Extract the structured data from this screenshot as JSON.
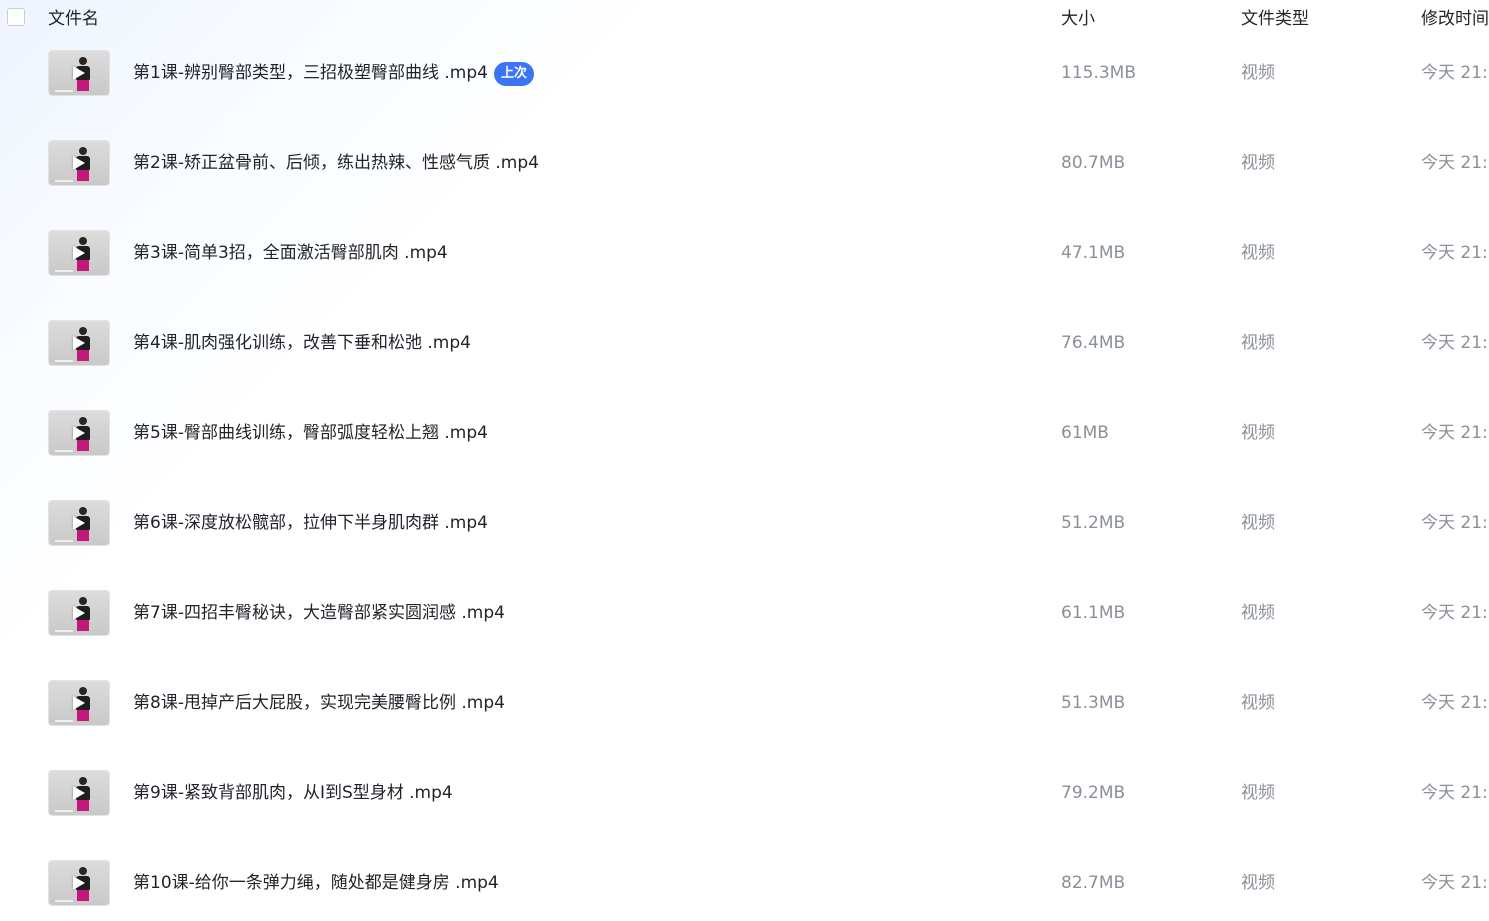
{
  "header": {
    "name_label": "文件名",
    "size_label": "大小",
    "type_label": "文件类型",
    "time_label": "修改时间"
  },
  "rows": [
    {
      "name": "第1课-辨别臀部类型，三招极塑臀部曲线 .mp4",
      "badge": "上次",
      "size": "115.3MB",
      "type": "视频",
      "time": "今天 21:"
    },
    {
      "name": "第2课-矫正盆骨前、后倾，练出热辣、性感气质 .mp4",
      "badge": "",
      "size": "80.7MB",
      "type": "视频",
      "time": "今天 21:"
    },
    {
      "name": "第3课-简单3招，全面激活臀部肌肉 .mp4",
      "badge": "",
      "size": "47.1MB",
      "type": "视频",
      "time": "今天 21:"
    },
    {
      "name": "第4课-肌肉强化训练，改善下垂和松弛 .mp4",
      "badge": "",
      "size": "76.4MB",
      "type": "视频",
      "time": "今天 21:"
    },
    {
      "name": "第5课-臀部曲线训练，臀部弧度轻松上翘 .mp4",
      "badge": "",
      "size": "61MB",
      "type": "视频",
      "time": "今天 21:"
    },
    {
      "name": "第6课-深度放松髋部，拉伸下半身肌肉群 .mp4",
      "badge": "",
      "size": "51.2MB",
      "type": "视频",
      "time": "今天 21:"
    },
    {
      "name": "第7课-四招丰臀秘诀，大造臀部紧实圆润感 .mp4",
      "badge": "",
      "size": "61.1MB",
      "type": "视频",
      "time": "今天 21:"
    },
    {
      "name": "第8课-甩掉产后大屁股，实现完美腰臀比例 .mp4",
      "badge": "",
      "size": "51.3MB",
      "type": "视频",
      "time": "今天 21:"
    },
    {
      "name": "第9课-紧致背部肌肉，从I到S型身材 .mp4",
      "badge": "",
      "size": "79.2MB",
      "type": "视频",
      "time": "今天 21:"
    },
    {
      "name": "第10课-给你一条弹力绳，随处都是健身房 .mp4",
      "badge": "",
      "size": "82.7MB",
      "type": "视频",
      "time": "今天 21:"
    }
  ],
  "colors": {
    "badge_bg": "#3b75f5",
    "meta_text": "#8a9099",
    "title_text": "#1f2329"
  },
  "icons": {
    "thumbnail_overlay": "play-icon",
    "header_select": "checkbox-icon"
  }
}
